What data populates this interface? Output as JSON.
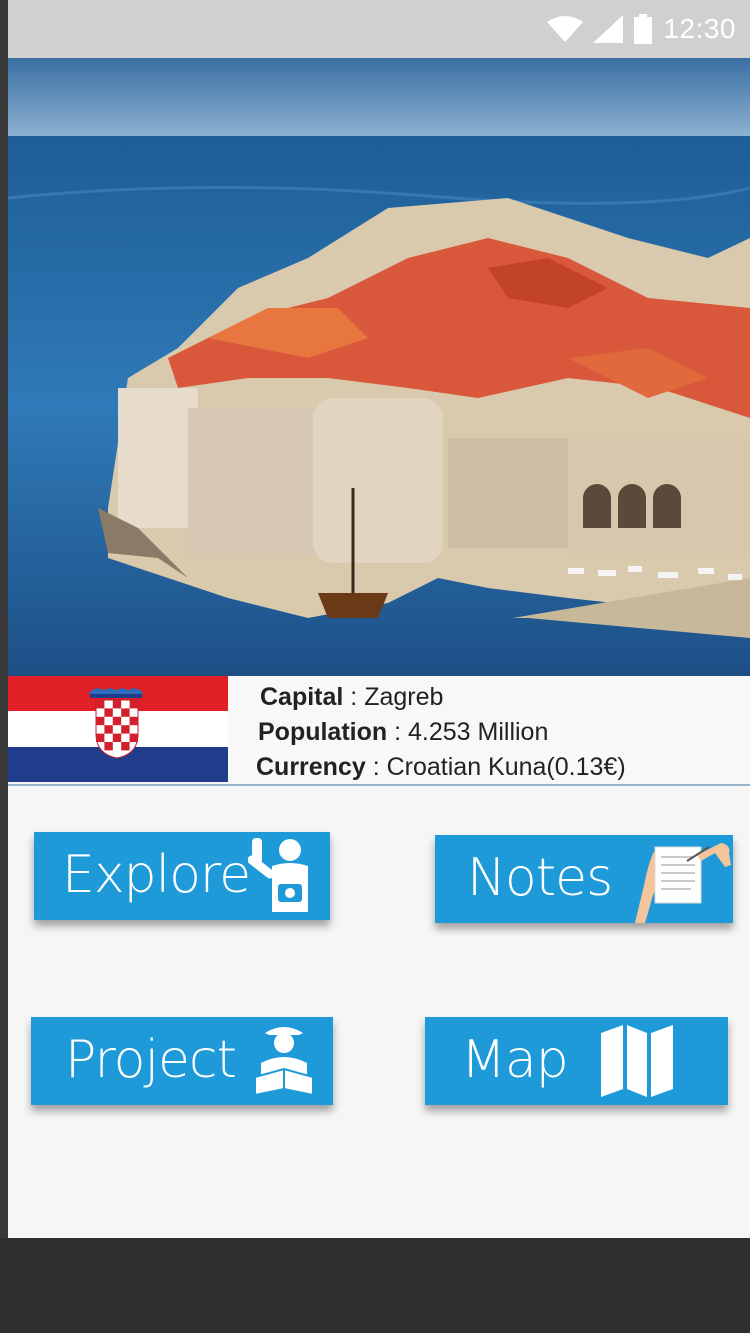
{
  "status_bar": {
    "time": "12:30",
    "icons": [
      "wifi-icon",
      "signal-icon",
      "battery-icon"
    ]
  },
  "hero": {
    "icon": "dubrovnik-photo"
  },
  "country": {
    "flag_icon": "croatia-flag-icon",
    "capital": {
      "label": "Capital",
      "sep": " : ",
      "value": "Zagreb"
    },
    "population": {
      "label": "Population",
      "sep": " : ",
      "value": "4.253 Million"
    },
    "currency": {
      "label": "Currency",
      "sep": " : ",
      "value": "Croatian Kuna(0.13€)"
    }
  },
  "buttons": {
    "explore": {
      "label": "Explore",
      "icon": "tourist-camera-icon"
    },
    "notes": {
      "label": "Notes",
      "icon": "clipboard-writing-icon"
    },
    "project": {
      "label": "Project",
      "icon": "reader-with-hat-icon"
    },
    "map": {
      "label": "Map",
      "icon": "folded-map-icon"
    }
  },
  "colors": {
    "accent": "#1f9ad8",
    "status_bar": "#d0d0d0",
    "nav_bar": "#2f2f2f"
  }
}
